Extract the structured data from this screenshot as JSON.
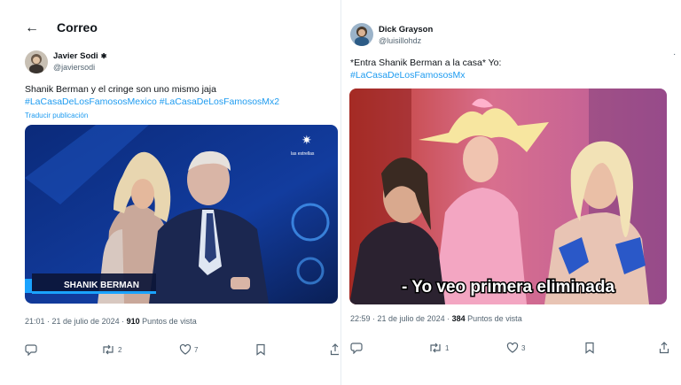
{
  "left": {
    "header": {
      "back_glyph": "←",
      "title": "Correo"
    },
    "tweet": {
      "author_name": "Javier Sodi",
      "verified_glyph": "✱",
      "handle": "@javiersodi",
      "text": "Shanik Berman y el cringe son uno mismo jaja",
      "hashtags": [
        "#LaCasaDeLosFamososMexico",
        "#LaCasaDeLosFamososMx2"
      ],
      "translate_label": "Traducir publicación",
      "media": {
        "caption": "SHANIK BERMAN",
        "channel_logo": "las estrellas"
      },
      "time_text": "21:01 · 21 de julio de 2024 ·",
      "views_count": "910",
      "views_label": "Puntos de vista",
      "replies_count": "",
      "retweets_count": "2",
      "likes_count": "7"
    }
  },
  "right": {
    "tweet": {
      "author_name": "Dick Grayson",
      "handle": "@luisillohdz",
      "more_glyph": "·",
      "text": "*Entra Shanik Berman a la casa* Yo:",
      "hashtags": [
        "#LaCasaDeLosFamososMx"
      ],
      "media": {
        "subtitle": "- Yo veo primera eliminada"
      },
      "time_text": "22:59 · 21 de julio de 2024 ·",
      "views_count": "384",
      "views_label": "Puntos de vista",
      "replies_count": "",
      "retweets_count": "1",
      "likes_count": "3"
    }
  },
  "colors": {
    "link": "#1d9bf0",
    "text": "#0f1419",
    "muted": "#536471"
  },
  "icons": [
    "back-arrow-icon",
    "verified-icon",
    "reply-icon",
    "retweet-icon",
    "like-icon",
    "bookmark-icon",
    "share-icon",
    "more-icon"
  ]
}
